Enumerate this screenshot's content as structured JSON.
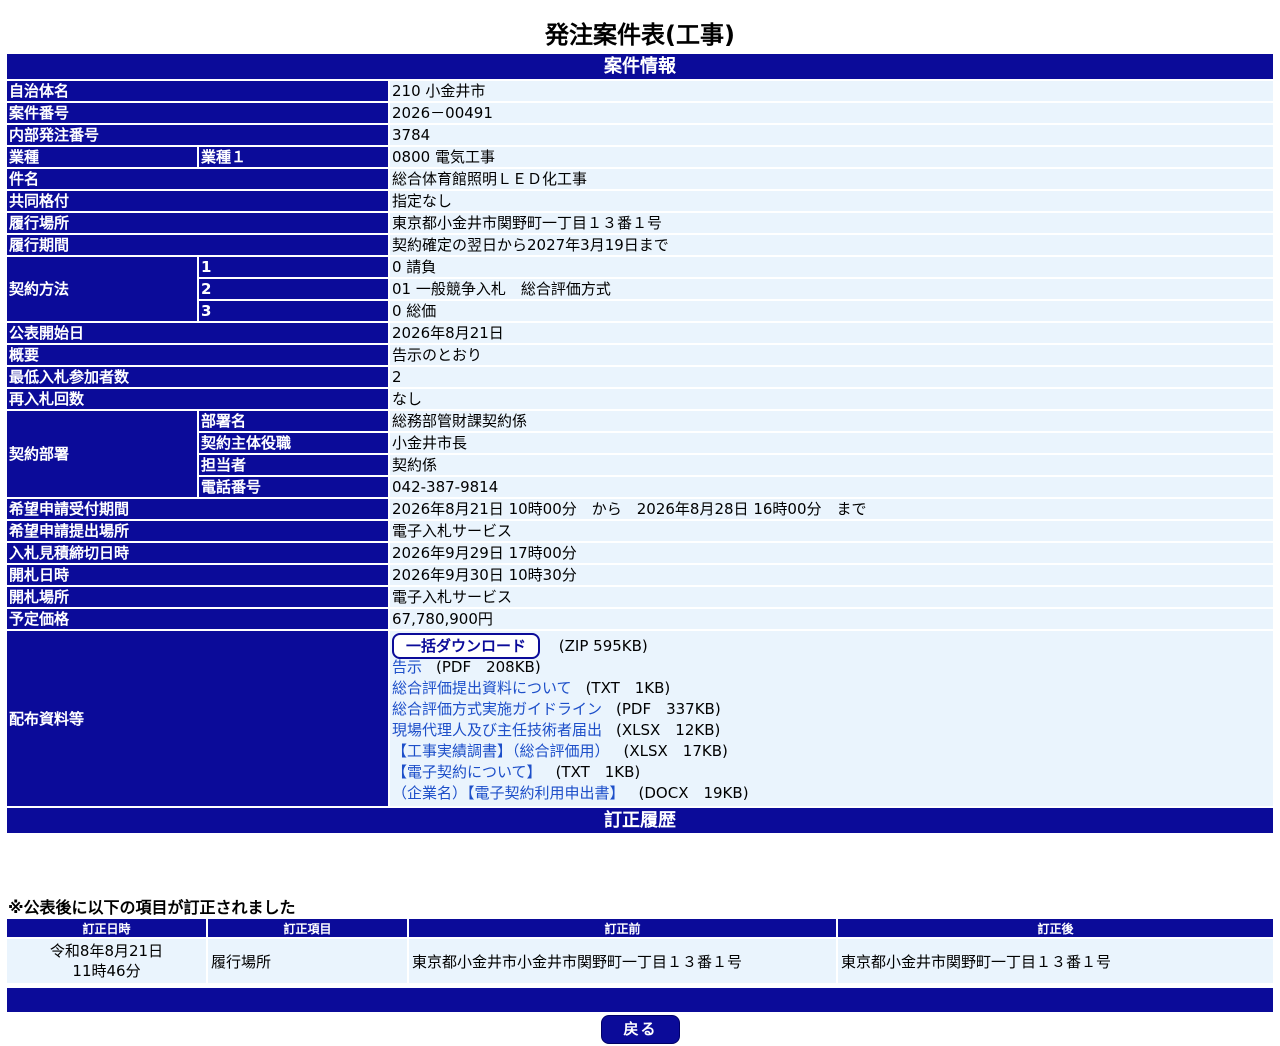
{
  "title": "発注案件表(工事)",
  "section_title": "案件情報",
  "fields": {
    "municipality": {
      "label": "自治体名",
      "value": "210 小金井市"
    },
    "case_number": {
      "label": "案件番号",
      "value": "2026－00491"
    },
    "internal_number": {
      "label": "内部発注番号",
      "value": "3784"
    },
    "industry": {
      "label": "業種",
      "sub_label": "業種１",
      "value": "0800 電気工事"
    },
    "subject": {
      "label": "件名",
      "value": "総合体育館照明ＬＥＤ化工事"
    },
    "joint_rating": {
      "label": "共同格付",
      "value": "指定なし"
    },
    "location": {
      "label": "履行場所",
      "value": "東京都小金井市関野町一丁目１３番１号"
    },
    "period": {
      "label": "履行期間",
      "value": "契約確定の翌日から2027年3月19日まで"
    },
    "contract_method": {
      "label": "契約方法",
      "rows": [
        {
          "num": "1",
          "value": "0 請負"
        },
        {
          "num": "2",
          "value": "01 一般競争入札　総合評価方式"
        },
        {
          "num": "3",
          "value": "0 総価"
        }
      ]
    },
    "publish_date": {
      "label": "公表開始日",
      "value": "2026年8月21日"
    },
    "summary": {
      "label": "概要",
      "value": "告示のとおり"
    },
    "min_bidders": {
      "label": "最低入札参加者数",
      "value": "2"
    },
    "rebid": {
      "label": "再入札回数",
      "value": "なし"
    },
    "dept": {
      "label": "契約部署",
      "rows": [
        {
          "label": "部署名",
          "value": "総務部管財課契約係"
        },
        {
          "label": "契約主体役職",
          "value": "小金井市長"
        },
        {
          "label": "担当者",
          "value": "契約係"
        },
        {
          "label": "電話番号",
          "value": "042-387-9814"
        }
      ]
    },
    "application_period": {
      "label": "希望申請受付期間",
      "value": "2026年8月21日 10時00分　から　2026年8月28日 16時00分　まで"
    },
    "application_place": {
      "label": "希望申請提出場所",
      "value": "電子入札サービス"
    },
    "bid_deadline": {
      "label": "入札見積締切日時",
      "value": "2026年9月29日 17時00分"
    },
    "opening_date": {
      "label": "開札日時",
      "value": "2026年9月30日 10時30分"
    },
    "opening_place": {
      "label": "開札場所",
      "value": "電子入札サービス"
    },
    "estimated_price": {
      "label": "予定価格",
      "value": "67,780,900円"
    }
  },
  "documents": {
    "label": "配布資料等",
    "bulk_download": "一括ダウンロード",
    "bulk_size": "(ZIP 595KB)",
    "files": [
      {
        "name": "告示",
        "size": "(PDF　208KB)"
      },
      {
        "name": "総合評価提出資料について",
        "size": "(TXT　1KB)"
      },
      {
        "name": "総合評価方式実施ガイドライン",
        "size": "(PDF　337KB)"
      },
      {
        "name": "現場代理人及び主任技術者届出",
        "size": "(XLSX　12KB)"
      },
      {
        "name": "【工事実績調書】（総合評価用）",
        "size": "(XLSX　17KB)"
      },
      {
        "name": "【電子契約について】",
        "size": "(TXT　1KB)"
      },
      {
        "name": "（企業名）【電子契約利用申出書】",
        "size": "(DOCX　19KB)"
      }
    ]
  },
  "history": {
    "title": "訂正履歴",
    "note": "※公表後に以下の項目が訂正されました",
    "columns": [
      "訂正日時",
      "訂正項目",
      "訂正前",
      "訂正後"
    ],
    "rows": [
      {
        "date": "令和8年8月21日",
        "time": "11時46分",
        "item": "履行場所",
        "before": "東京都小金井市小金井市関野町一丁目１３番１号",
        "after": "東京都小金井市関野町一丁目１３番１号"
      }
    ]
  },
  "back_button": "戻る"
}
